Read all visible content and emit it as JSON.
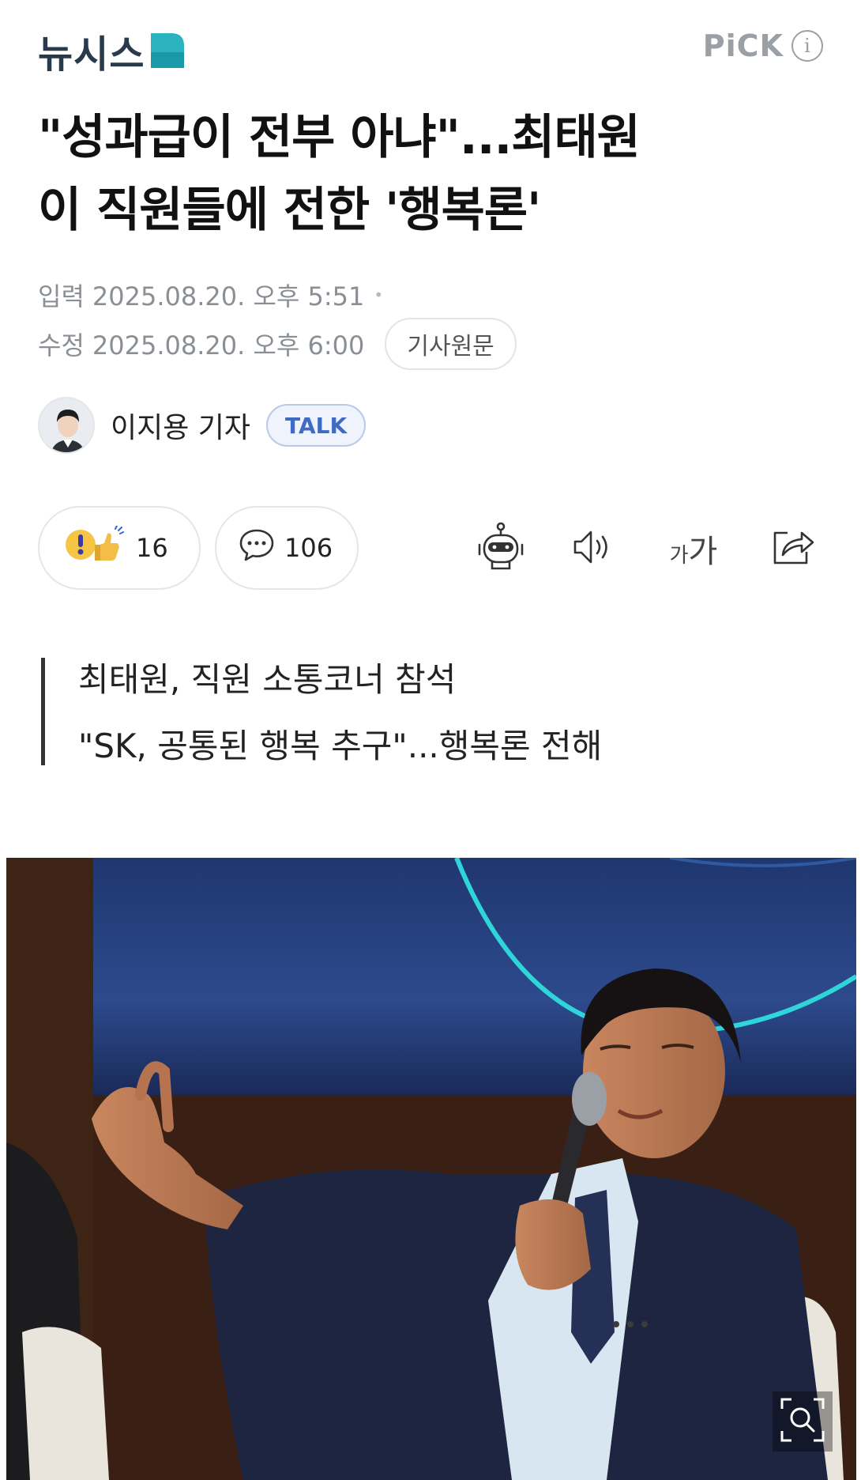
{
  "header": {
    "logo_text": "뉴시스",
    "pick_label": "PiCK",
    "info_icon": "i"
  },
  "article": {
    "title_line1": "\"성과급이 전부 아냐\"...최태원",
    "title_line2": "이 직원들에 전한 '행복론'",
    "published_label": "입력",
    "published_value": "2025.08.20. 오후 5:51",
    "modified_label": "수정",
    "modified_value": "2025.08.20. 오후 6:00",
    "source_button": "기사원문"
  },
  "reporter": {
    "name": "이지용 기자",
    "talk_button": "TALK"
  },
  "actions": {
    "reaction_count": "16",
    "comment_count": "106",
    "font_small": "가",
    "font_big": "가"
  },
  "summary": {
    "line1": "최태원, 직원 소통코너 참석",
    "line2": "\"SK, 공통된 행복 추구\"...행복론 전해"
  },
  "icons": {
    "reaction": "reaction-emoji-icon",
    "comment": "speech-bubble-icon",
    "summary_bot": "robot-icon",
    "tts": "speaker-icon",
    "font": "font-size-icon",
    "share": "share-icon",
    "zoom": "zoom-icon"
  },
  "colors": {
    "logo_dark": "#2a3a4d",
    "logo_accent": "#2bb3c0",
    "talk_blue": "#3f6bc4",
    "meta_gray": "#8a8f95"
  }
}
